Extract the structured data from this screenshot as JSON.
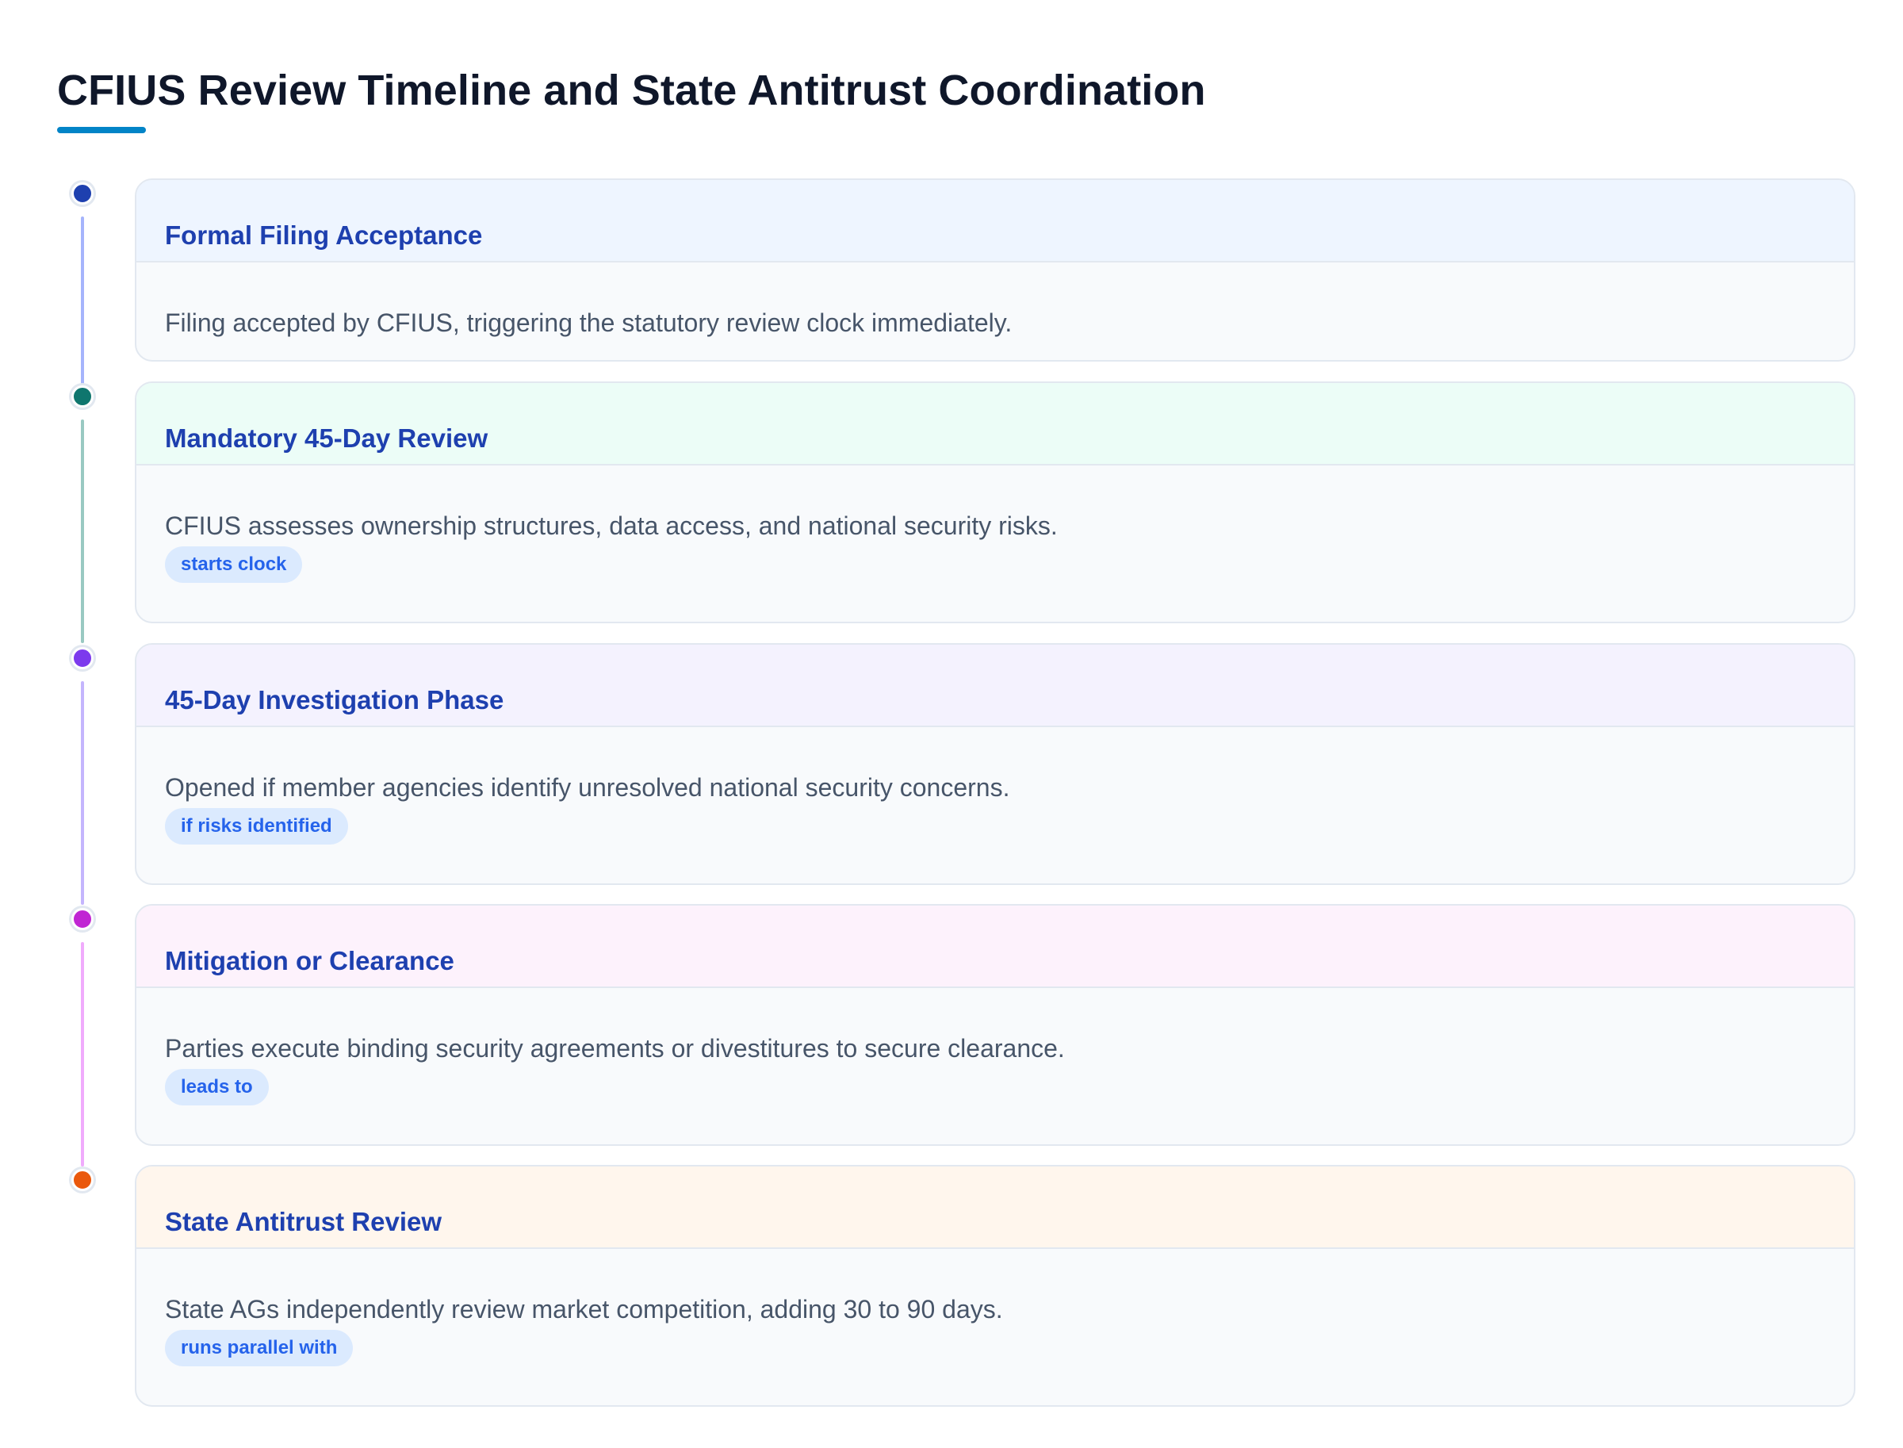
{
  "title": "CFIUS Review Timeline and State Antitrust Coordination",
  "steps": [
    {
      "title": "Formal Filing Acceptance",
      "description": "Filing accepted by CFIUS, triggering the statutory review clock immediately.",
      "tag": "",
      "node_color": "#1e40af",
      "header_color": "#eef5ff",
      "connector_color": "#a5b4fc"
    },
    {
      "title": "Mandatory 45-Day Review",
      "description": "CFIUS assesses ownership structures, data access, and national security risks.",
      "tag": "starts clock",
      "node_color": "#0f766e",
      "header_color": "#ecfdf7",
      "connector_color": "#99c9c2"
    },
    {
      "title": "45-Day Investigation Phase",
      "description": "Opened if member agencies identify unresolved national security concerns.",
      "tag": "if risks identified",
      "node_color": "#7c3aed",
      "header_color": "#f4f2fe",
      "connector_color": "#c4b5fd"
    },
    {
      "title": "Mitigation or Clearance",
      "description": "Parties execute binding security agreements or divestitures to secure clearance.",
      "tag": "leads to",
      "node_color": "#c026d3",
      "header_color": "#fdf2fc",
      "connector_color": "#f0abfc"
    },
    {
      "title": "State Antitrust Review",
      "description": "State AGs independently review market competition, adding 30 to 90 days.",
      "tag": "runs parallel with",
      "node_color": "#ea580c",
      "header_color": "#fff6ed",
      "connector_color": ""
    }
  ]
}
